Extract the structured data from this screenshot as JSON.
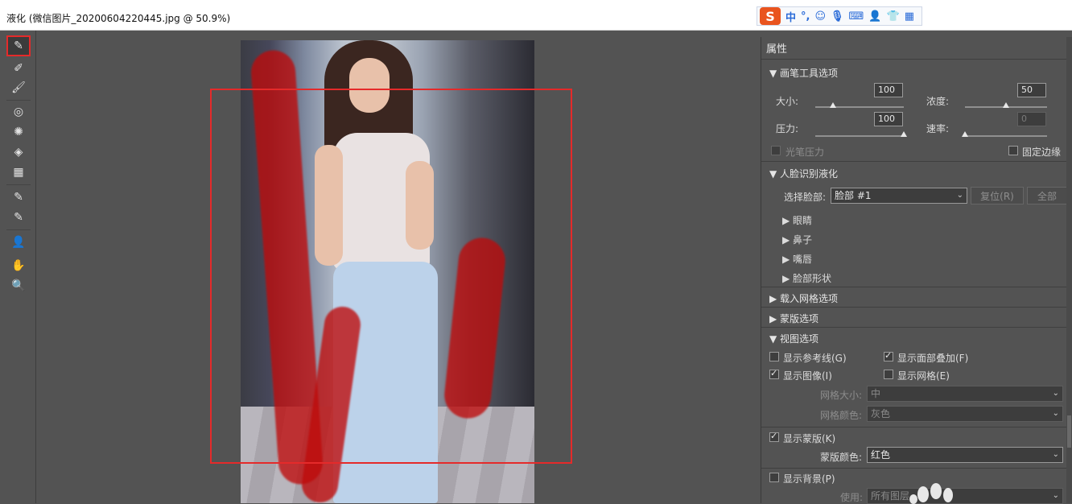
{
  "window": {
    "title": "液化 (微信图片_20200604220445.jpg @ 50.9%)"
  },
  "ime": {
    "logo": "S",
    "items": [
      "中",
      "°,",
      "☺",
      "🎙",
      "⌨",
      "👤",
      "👕",
      "▦"
    ]
  },
  "toolbar": {
    "tools": [
      {
        "name": "forward-warp-tool",
        "icon": "✎"
      },
      {
        "name": "reconstruct-tool",
        "icon": "✐"
      },
      {
        "name": "smooth-tool",
        "icon": "🖌"
      },
      {
        "name": "twirl-tool",
        "icon": "◎"
      },
      {
        "name": "pucker-tool",
        "icon": "✺"
      },
      {
        "name": "bloat-tool",
        "icon": "◈"
      },
      {
        "name": "push-left-tool",
        "icon": "▦"
      },
      {
        "name": "freeze-mask-tool",
        "icon": "✎"
      },
      {
        "name": "thaw-mask-tool",
        "icon": "✎"
      },
      {
        "name": "face-tool",
        "icon": "👤"
      },
      {
        "name": "hand-tool",
        "icon": "✋"
      },
      {
        "name": "zoom-tool",
        "icon": "🔍"
      }
    ]
  },
  "panel": {
    "header": "属性",
    "brush": {
      "title": "▼ 画笔工具选项",
      "size_label": "大小:",
      "size_value": "100",
      "density_label": "浓度:",
      "density_value": "50",
      "pressure_label": "压力:",
      "pressure_value": "100",
      "rate_label": "速率:",
      "rate_value": "0",
      "size_level": 0.2,
      "density_level": 0.5,
      "pressure_level": 1.0,
      "rate_level": 0.0,
      "stylus_label": "光笔压力",
      "pin_edges_label": "固定边缘"
    },
    "face": {
      "title": "▼ 人脸识别液化",
      "select_face_label": "选择脸部:",
      "select_face_value": "脸部 #1",
      "reset_label": "复位(R)",
      "all_label": "全部",
      "items": [
        "▶ 眼睛",
        "▶ 鼻子",
        "▶ 嘴唇",
        "▶ 脸部形状"
      ]
    },
    "load_mesh_title": "▶ 载入网格选项",
    "mask_title": "▶ 蒙版选项",
    "view": {
      "title": "▼ 视图选项",
      "show_guides": "显示参考线(G)",
      "show_face_overlay": "显示面部叠加(F)",
      "show_image": "显示图像(I)",
      "show_mesh": "显示网格(E)",
      "mesh_size_label": "网格大小:",
      "mesh_size_value": "中",
      "mesh_color_label": "网格颜色:",
      "mesh_color_value": "灰色",
      "show_mask": "显示蒙版(K)",
      "mask_color_label": "蒙版颜色:",
      "mask_color_value": "红色",
      "show_backdrop": "显示背景(P)",
      "use_label": "使用:",
      "use_value": "所有图层"
    }
  },
  "colors": {
    "highlight_red": "#e52a2a",
    "mask_red": "#be0a0a",
    "panel_bg": "#535353"
  }
}
